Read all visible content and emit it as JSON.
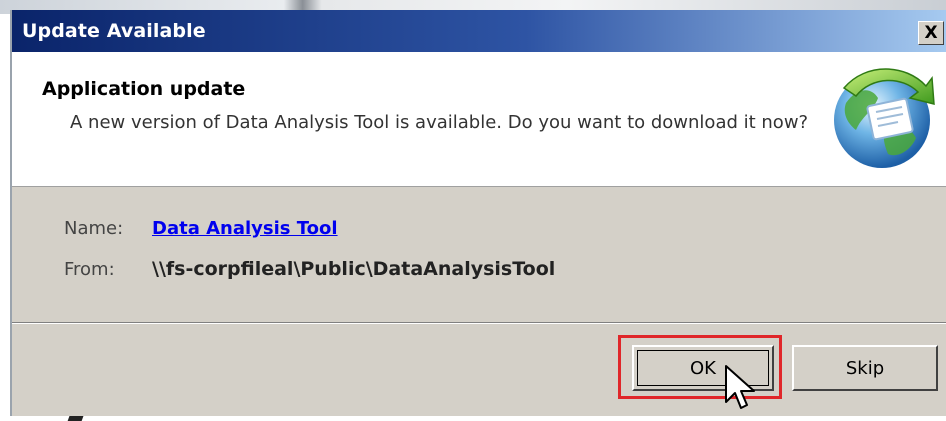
{
  "window": {
    "title": "Update Available",
    "close_glyph": "X"
  },
  "header": {
    "heading": "Application update",
    "description": "A new version of Data Analysis Tool is available. Do you want to download it now?",
    "icon": "globe-update-icon"
  },
  "details": {
    "name_label": "Name:",
    "name_value": "Data Analysis Tool",
    "from_label": "From:",
    "from_value": "\\\\fs-corpfileal\\Public\\DataAnalysisTool"
  },
  "buttons": {
    "ok_label": "OK",
    "skip_label": "Skip"
  },
  "annotations": {
    "highlight_color": "#e0262a",
    "highlight_target": "OK button"
  },
  "colors": {
    "titlebar_start": "#0a246a",
    "titlebar_end": "#a6caf0",
    "link": "#0000ee",
    "dialog_face": "#d4d0c8"
  }
}
